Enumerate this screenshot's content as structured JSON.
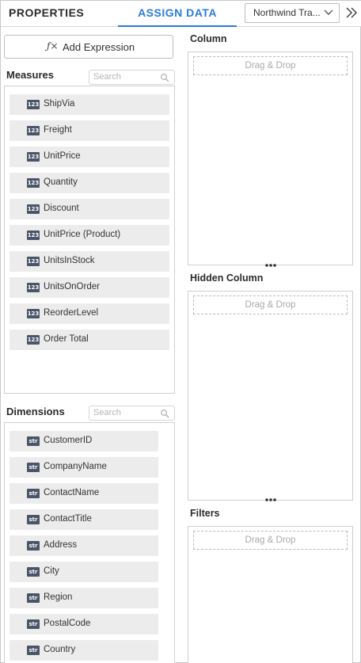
{
  "header": {
    "tab_properties": "PROPERTIES",
    "tab_assign_data": "ASSIGN DATA",
    "datasource_selected": "Northwind Tra...",
    "accent_color": "#2b7bdc"
  },
  "expression": {
    "label": "Add Expression",
    "icon_glyph": "ƒ×"
  },
  "measures": {
    "title": "Measures",
    "search_placeholder": "Search",
    "type_badge": "123",
    "items": [
      "ShipVia",
      "Freight",
      "UnitPrice",
      "Quantity",
      "Discount",
      "UnitPrice (Product)",
      "UnitsInStock",
      "UnitsOnOrder",
      "ReorderLevel",
      "Order Total"
    ]
  },
  "dimensions": {
    "title": "Dimensions",
    "search_placeholder": "Search",
    "type_badge": "str",
    "items": [
      "CustomerID",
      "CompanyName",
      "ContactName",
      "ContactTitle",
      "Address",
      "City",
      "Region",
      "PostalCode",
      "Country"
    ]
  },
  "drop_sections": {
    "column": {
      "title": "Column",
      "placeholder": "Drag & Drop"
    },
    "hidden_column": {
      "title": "Hidden Column",
      "placeholder": "Drag & Drop"
    },
    "filters": {
      "title": "Filters",
      "placeholder": "Drag & Drop"
    }
  }
}
